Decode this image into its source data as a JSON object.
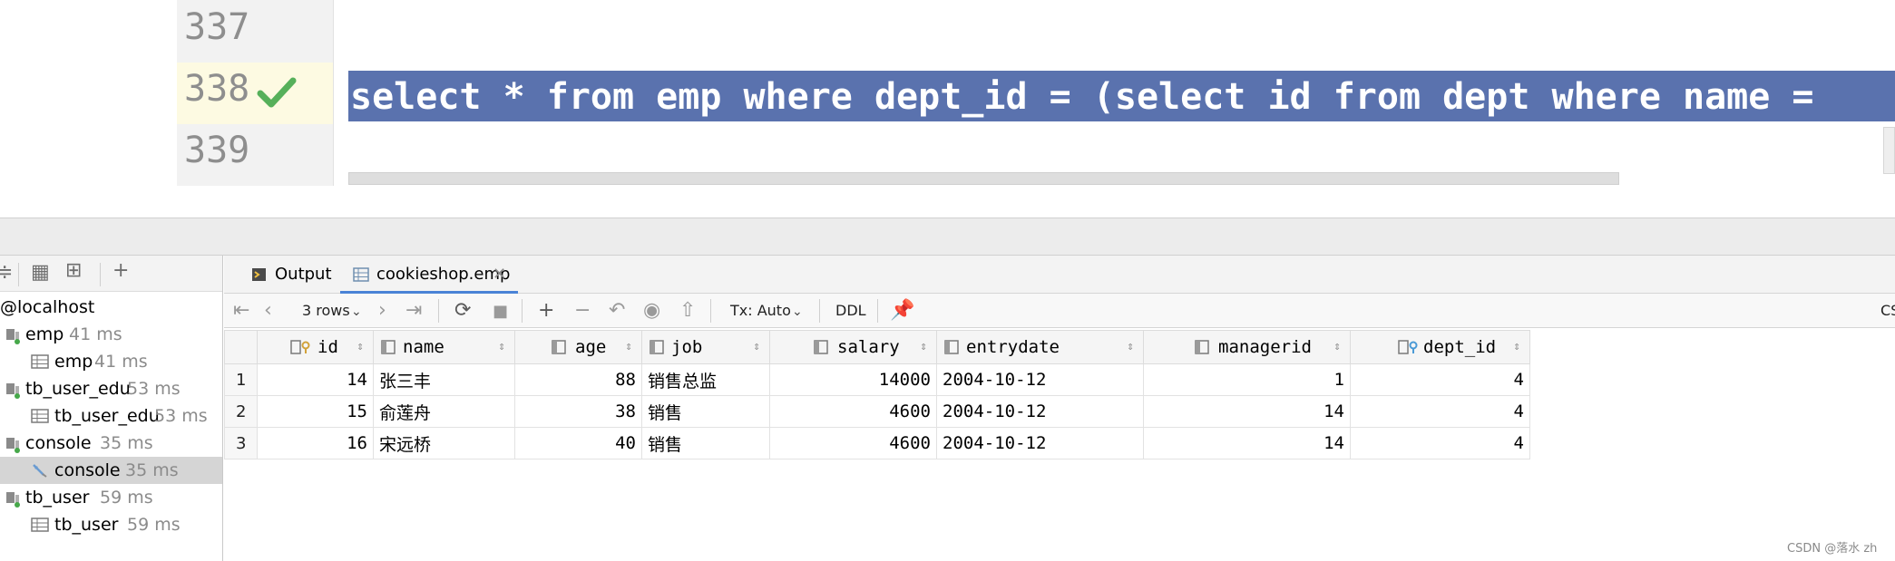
{
  "editor": {
    "lines": [
      {
        "no": "337",
        "code": ""
      },
      {
        "no": "338",
        "code": "select * from emp where dept_id = (select id from dept where name = "
      },
      {
        "no": "339",
        "code": ""
      }
    ],
    "active_line_status": "check-icon"
  },
  "services": {
    "root": "@localhost",
    "items": [
      {
        "label": "emp",
        "time": "41 ms",
        "kind": "session"
      },
      {
        "label": "emp",
        "time": "41 ms",
        "kind": "table"
      },
      {
        "label": "tb_user_edu",
        "time": "53 ms",
        "kind": "session"
      },
      {
        "label": "tb_user_edu",
        "time": "53 ms",
        "kind": "table"
      },
      {
        "label": "console",
        "time": "35 ms",
        "kind": "session"
      },
      {
        "label": "console",
        "time": "35 ms",
        "kind": "console"
      },
      {
        "label": "tb_user",
        "time": "59 ms",
        "kind": "session"
      },
      {
        "label": "tb_user",
        "time": "59 ms",
        "kind": "table"
      }
    ]
  },
  "results": {
    "tabs": [
      {
        "label": "Output"
      },
      {
        "label": "cookieshop.emp"
      }
    ],
    "toolbar": {
      "rows_label": "3 rows",
      "tx_label": "Tx: Auto",
      "ddl_label": "DDL",
      "right_clip": "CS"
    },
    "columns": [
      "id",
      "name",
      "age",
      "job",
      "salary",
      "entrydate",
      "managerid",
      "dept_id"
    ],
    "rows": [
      {
        "n": "1",
        "id": "14",
        "name": "张三丰",
        "age": "88",
        "job": "销售总监",
        "salary": "14000",
        "entrydate": "2004-10-12",
        "managerid": "1",
        "dept_id": "4"
      },
      {
        "n": "2",
        "id": "15",
        "name": "俞莲舟",
        "age": "38",
        "job": "销售",
        "salary": "4600",
        "entrydate": "2004-10-12",
        "managerid": "14",
        "dept_id": "4"
      },
      {
        "n": "3",
        "id": "16",
        "name": "宋远桥",
        "age": "40",
        "job": "销售",
        "salary": "4600",
        "entrydate": "2004-10-12",
        "managerid": "14",
        "dept_id": "4"
      }
    ]
  },
  "watermark": "CSDN @落水 zh",
  "colors": {
    "selection": "#5a72ae",
    "active_gutter": "#fdfae2",
    "check": "#56b05a"
  }
}
